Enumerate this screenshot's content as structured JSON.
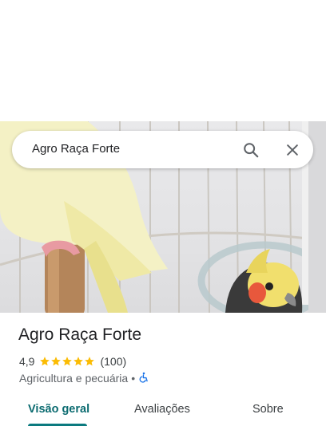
{
  "search": {
    "query": "Agro Raça Forte"
  },
  "place": {
    "title": "Agro Raça Forte",
    "rating": "4,9",
    "star_count": 5,
    "reviews": "(100)",
    "category": "Agricultura e pecuária",
    "separator": "•"
  },
  "tabs": [
    {
      "label": "Visão geral",
      "active": true
    },
    {
      "label": "Avaliações",
      "active": false
    },
    {
      "label": "Sobre",
      "active": false
    }
  ],
  "colors": {
    "accent": "#0b7a7f",
    "star": "#fbbc04",
    "accessibility_icon": "#1a73e8"
  },
  "icons": {
    "search": "search-icon",
    "close": "close-icon",
    "accessibility": "wheelchair-icon",
    "star": "star-icon"
  }
}
